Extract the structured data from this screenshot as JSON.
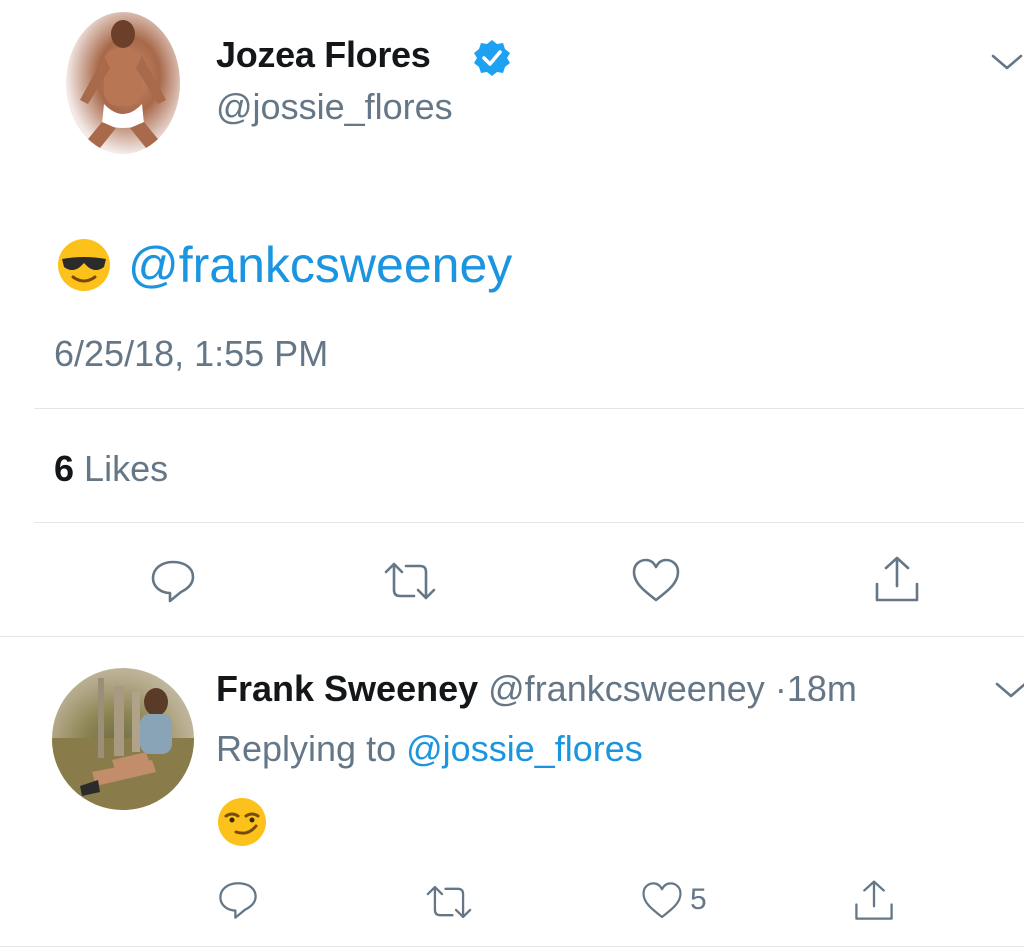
{
  "tweet": {
    "author_name": "Jozea Flores",
    "author_handle": "@jossie_flores",
    "mention": "@frankcsweeney",
    "timestamp": "6/25/18, 1:55 PM",
    "likes_count": "6",
    "likes_label": "Likes"
  },
  "reply": {
    "author_name": "Frank Sweeney",
    "author_handle": "@frankcsweeney",
    "separator": "·",
    "time_ago": "18m",
    "replying_prefix": "Replying to",
    "replying_to": "@jossie_flores",
    "like_count": "5"
  },
  "colors": {
    "link": "#1b95e0",
    "secondary_text": "#657786",
    "divider": "#e1e8ed",
    "verified": "#1da1f2"
  },
  "icons": {
    "verified": "verified-badge-icon",
    "menu": "chevron-down-icon",
    "reply": "reply-icon",
    "retweet": "retweet-icon",
    "like": "heart-icon",
    "share": "share-icon",
    "emoji_tweet": "sunglasses-emoji-icon",
    "emoji_reply": "smirk-emoji-icon"
  }
}
